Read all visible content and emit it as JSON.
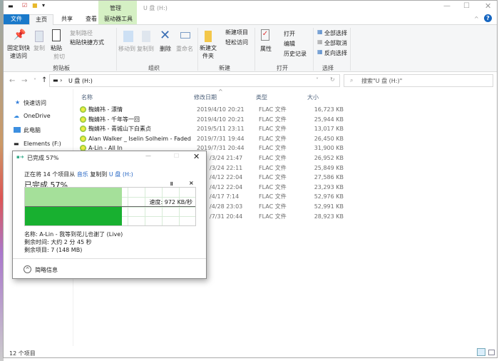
{
  "title": {
    "context_tab": "管理",
    "text": "U 盘 (H:)",
    "help": "?"
  },
  "tabs": [
    "文件",
    "主页",
    "共享",
    "查看",
    "驱动器工具"
  ],
  "ribbon": {
    "clipboard": {
      "pin": "固定到快速访问",
      "copy": "复制",
      "paste": "粘贴",
      "copy_path": "复制路径",
      "paste_shortcut": "粘贴快捷方式",
      "cut": "剪切",
      "group": "剪贴板"
    },
    "organize": {
      "move": "移动到",
      "copyto": "复制到",
      "delete": "删除",
      "rename": "重命名",
      "group": "组织"
    },
    "new": {
      "folder": "新建文件夹",
      "item": "新建项目",
      "easy": "轻松访问",
      "group": "新建"
    },
    "open": {
      "props": "属性",
      "open": "打开",
      "edit": "编辑",
      "history": "历史记录",
      "group": "打开"
    },
    "select": {
      "all": "全部选择",
      "none": "全部取消",
      "invert": "反向选择",
      "group": "选择"
    }
  },
  "address": {
    "path": "U 盘 (H:)",
    "search_placeholder": "搜索\"U 盘 (H:)\""
  },
  "nav": [
    "快速访问",
    "OneDrive",
    "此电脑",
    "Elements (F:)"
  ],
  "columns": [
    "名称",
    "修改日期",
    "类型",
    "大小"
  ],
  "files": [
    {
      "name": "鞠婧祎 - 漂情",
      "date": "2019/4/10 20:21",
      "type": "FLAC 文件",
      "size": "16,723 KB"
    },
    {
      "name": "鞠婧祎 - 千年等一回",
      "date": "2019/4/10 20:21",
      "type": "FLAC 文件",
      "size": "25,944 KB"
    },
    {
      "name": "鞠婧祎 - 青城山下白素贞",
      "date": "2019/5/11 23:11",
      "type": "FLAC 文件",
      "size": "13,017 KB"
    },
    {
      "name": "Alan Walker _ Iselin Solheim - Faded",
      "date": "2019/7/31 19:44",
      "type": "FLAC 文件",
      "size": "26,450 KB"
    },
    {
      "name": "A-Lin - All In",
      "date": "2019/7/31 20:44",
      "type": "FLAC 文件",
      "size": "31,900 KB"
    },
    {
      "name": "",
      "date": "/3/24 21:47",
      "type": "FLAC 文件",
      "size": "26,952 KB"
    },
    {
      "name": "",
      "date": "/3/24 22:11",
      "type": "FLAC 文件",
      "size": "25,849 KB"
    },
    {
      "name": "",
      "date": "/4/12 22:04",
      "type": "FLAC 文件",
      "size": "27,586 KB"
    },
    {
      "name": "",
      "date": "/4/12 22:04",
      "type": "FLAC 文件",
      "size": "23,293 KB"
    },
    {
      "name": "",
      "date": "/4/17 7:14",
      "type": "FLAC 文件",
      "size": "52,976 KB"
    },
    {
      "name": "",
      "date": "/4/28 23:03",
      "type": "FLAC 文件",
      "size": "52,991 KB"
    },
    {
      "name": "",
      "date": "/7/31 20:44",
      "type": "FLAC 文件",
      "size": "28,923 KB"
    }
  ],
  "status": "12 个项目",
  "dialog": {
    "title": "已完成 57%",
    "line_pre": "正在将 14 个项目从",
    "src": "音乐",
    "mid": "复制到",
    "dst": "U 盘 (H:)",
    "heading": "已完成 57%",
    "progress": 57,
    "speed": "速度: 972 KB/秒",
    "name": "名称: A-Lin - 我等到花儿也谢了 (Live)",
    "time": "剩余时间: 大约 2 分 45 秒",
    "items": "剩余项目: 7 (148 MB)",
    "less": "简略信息"
  }
}
